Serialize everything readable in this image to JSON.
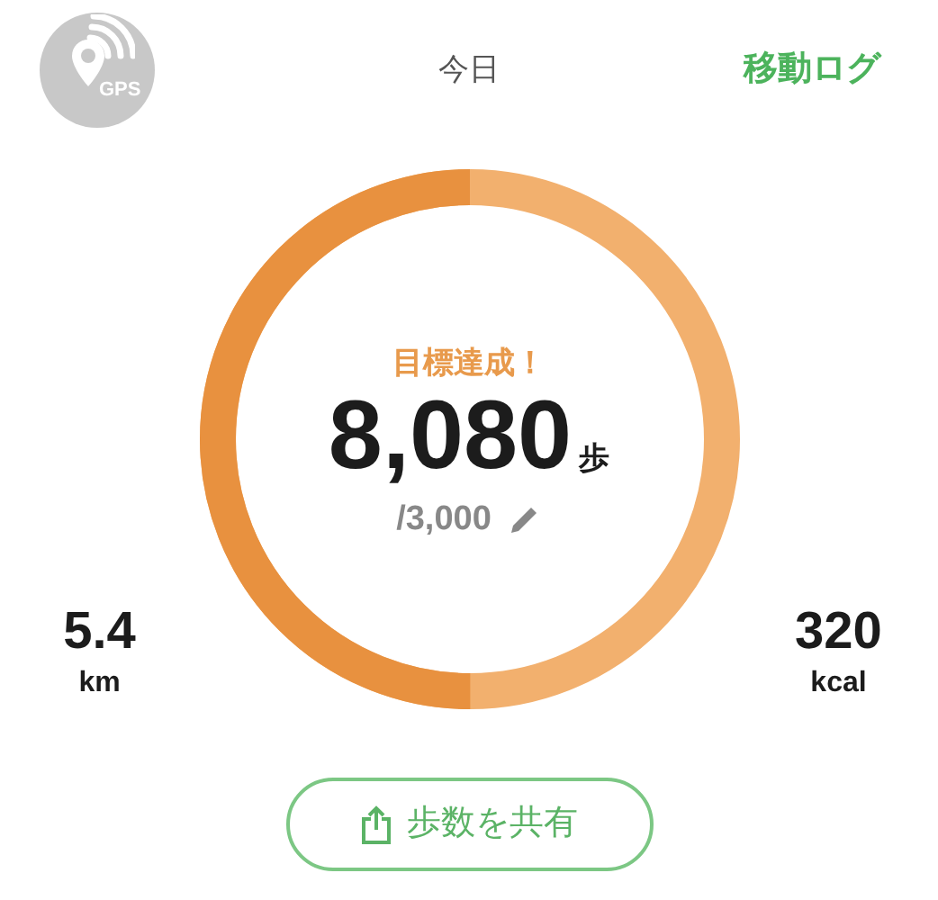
{
  "header": {
    "gps_label": "GPS",
    "title": "今日",
    "link": "移動ログ"
  },
  "ring": {
    "level": 0.5,
    "status": "目標達成！",
    "steps": "8,080",
    "unit": "歩",
    "goal": "/3,000"
  },
  "stats": [
    {
      "value": "5.4",
      "unit": "km"
    },
    {
      "value": "320",
      "unit": "kcal"
    }
  ],
  "share_button": {
    "label": "歩数を共有"
  }
}
